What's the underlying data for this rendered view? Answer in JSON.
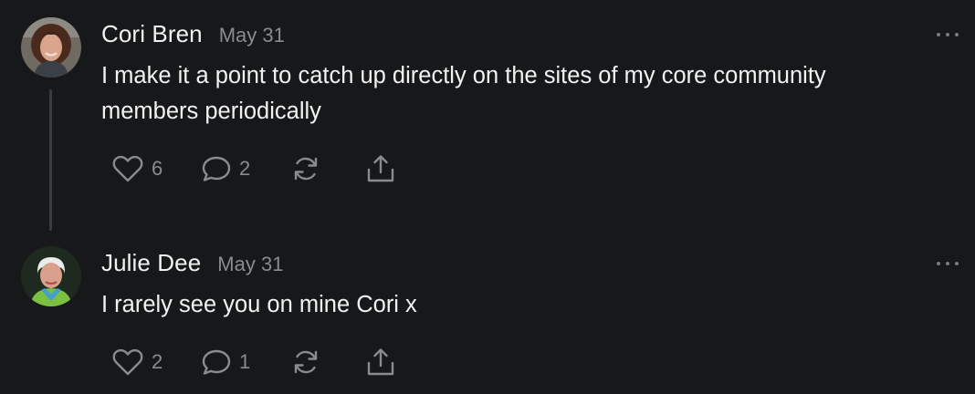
{
  "comments": [
    {
      "author": "Cori Bren",
      "date": "May 31",
      "text": "I make it a point to catch up directly on the sites of my core community members periodically",
      "likes": "6",
      "replies": "2",
      "avatar_icon": "user-photo-avatar"
    },
    {
      "author": "Julie Dee",
      "date": "May 31",
      "text": "I rarely see you on mine Cori x",
      "likes": "2",
      "replies": "1",
      "avatar_icon": "user-photo-avatar"
    }
  ],
  "icons": {
    "like": "heart-icon",
    "reply": "speech-bubble-icon",
    "restack": "restack-icon",
    "share": "share-icon",
    "more": "more-options-icon"
  },
  "colors": {
    "background": "#17181a",
    "text": "#f2f2f2",
    "muted": "#8a8b8f",
    "thread_line": "#3a3b3e"
  }
}
